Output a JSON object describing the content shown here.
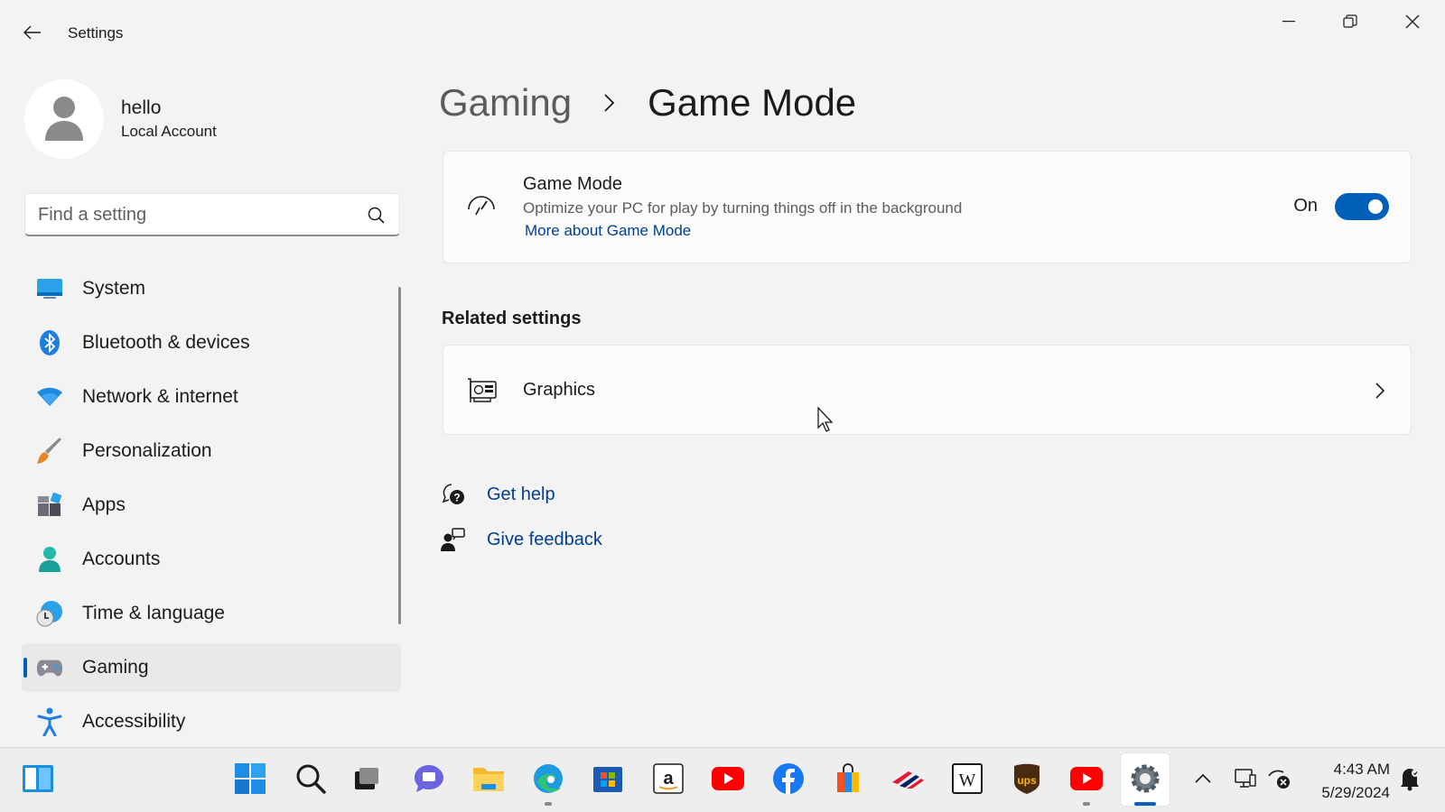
{
  "window": {
    "title": "Settings"
  },
  "profile": {
    "name": "hello",
    "account_type": "Local Account"
  },
  "search": {
    "placeholder": "Find a setting"
  },
  "sidebar": {
    "items": [
      {
        "label": "System",
        "icon": "monitor-icon"
      },
      {
        "label": "Bluetooth & devices",
        "icon": "bluetooth-icon"
      },
      {
        "label": "Network & internet",
        "icon": "wifi-icon"
      },
      {
        "label": "Personalization",
        "icon": "paintbrush-icon"
      },
      {
        "label": "Apps",
        "icon": "apps-icon"
      },
      {
        "label": "Accounts",
        "icon": "person-icon"
      },
      {
        "label": "Time & language",
        "icon": "clock-globe-icon"
      },
      {
        "label": "Gaming",
        "icon": "gamepad-icon",
        "active": true
      },
      {
        "label": "Accessibility",
        "icon": "accessibility-icon"
      }
    ]
  },
  "breadcrumb": {
    "parent": "Gaming",
    "current": "Game Mode"
  },
  "game_mode": {
    "title": "Game Mode",
    "description": "Optimize your PC for play by turning things off in the background",
    "link": "More about Game Mode",
    "toggle_label": "On",
    "toggle_on": true
  },
  "related": {
    "heading": "Related settings",
    "graphics_label": "Graphics"
  },
  "help": {
    "get_help": "Get help",
    "give_feedback": "Give feedback"
  },
  "taskbar": {
    "apps": [
      "widgets",
      "start",
      "search",
      "task-view",
      "chat",
      "file-explorer",
      "edge",
      "store",
      "amazon",
      "youtube",
      "facebook",
      "shopping",
      "bank-of-america",
      "wikipedia",
      "ups",
      "youtube-2",
      "settings"
    ],
    "time": "4:43 AM",
    "date": "5/29/2024"
  },
  "colors": {
    "accent": "#005fb8",
    "link": "#003e92",
    "background": "#f3f3f3"
  }
}
